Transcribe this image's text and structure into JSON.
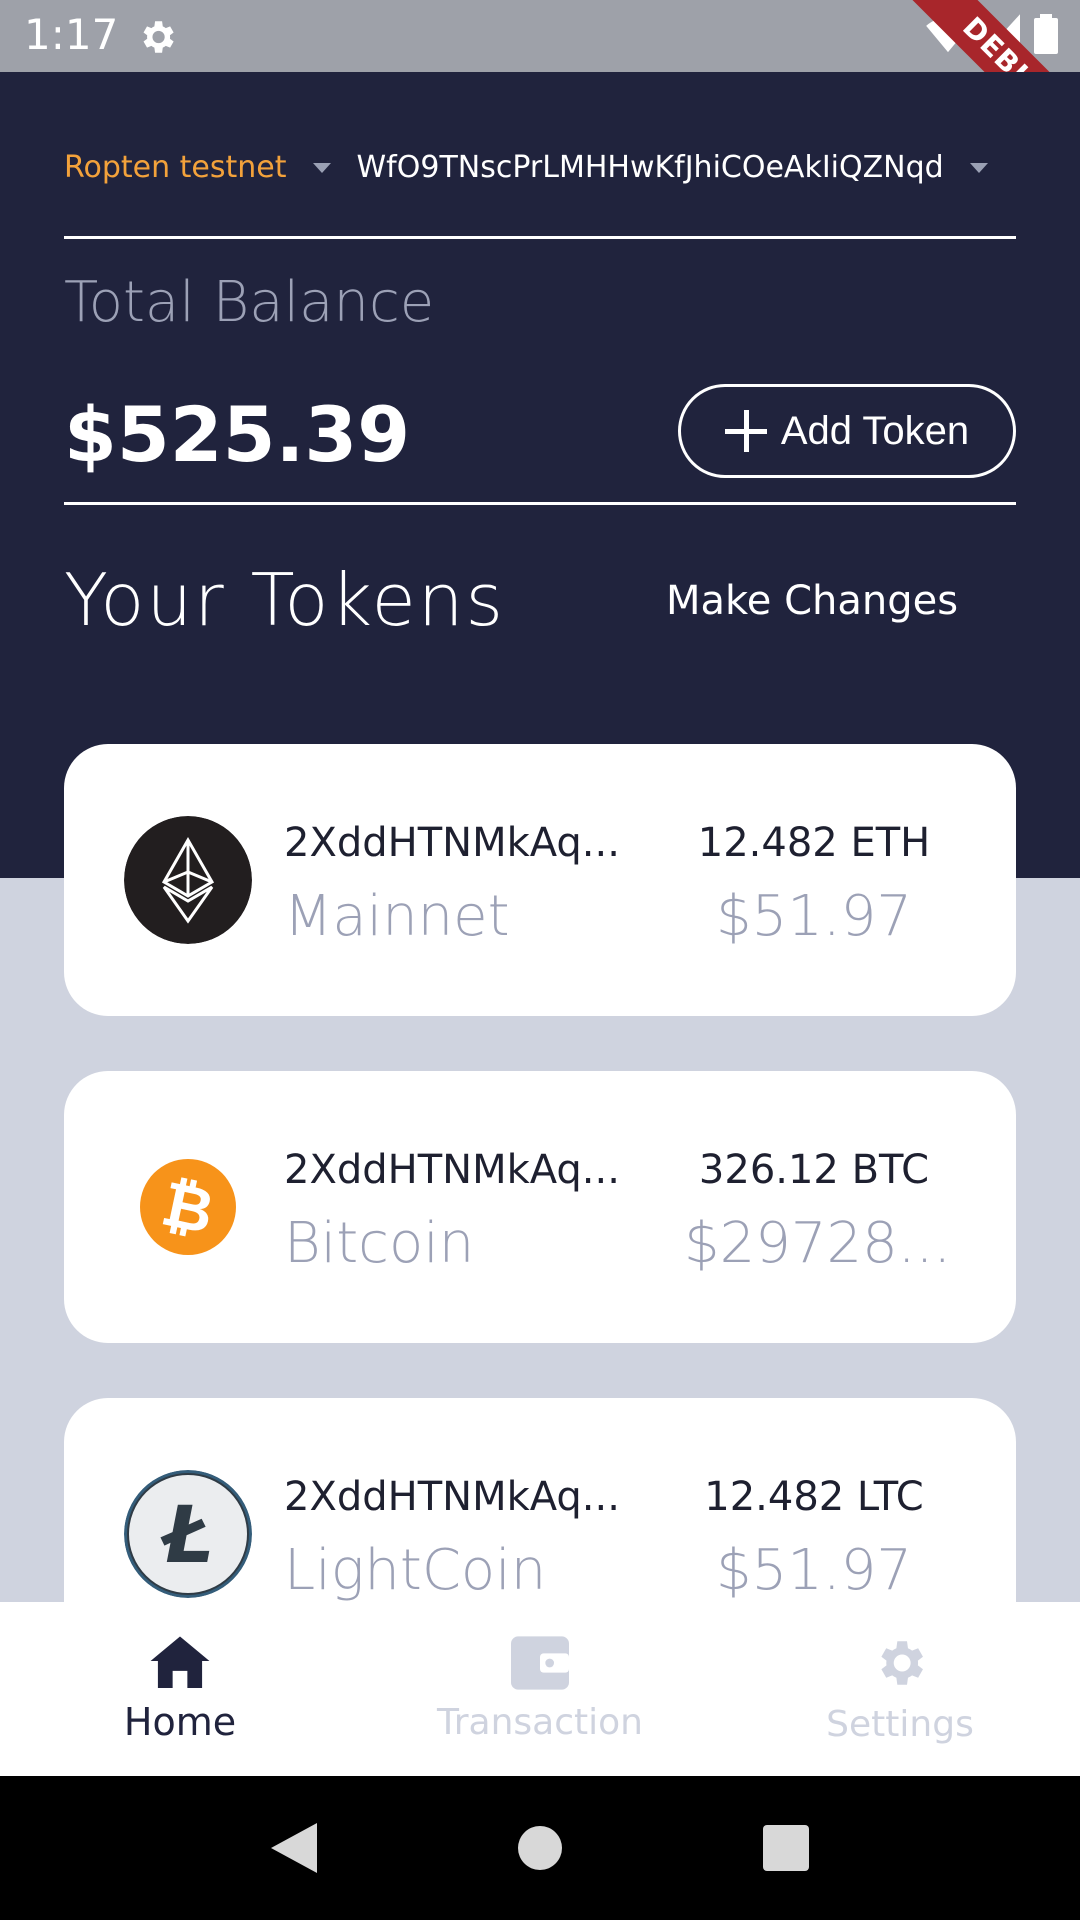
{
  "status_bar": {
    "time": "1:17",
    "debug_label": "DEBUG"
  },
  "header": {
    "network": "Ropten testnet",
    "account": "WfO9TNscPrLMHHwKfJhiCOeAkIiQZNqd",
    "total_label": "Total Balance",
    "balance": "$525.39",
    "add_token_label": "Add Token",
    "tokens_title": "Your Tokens",
    "make_changes_label": "Make Changes"
  },
  "tokens": [
    {
      "address": "2XddHTNMkAq...",
      "name": "Mainnet",
      "amount": "12.482 ETH",
      "usd": "$51.97",
      "icon": "ethereum-icon"
    },
    {
      "address": "2XddHTNMkAq...",
      "name": "Bitcoin",
      "amount": "326.12 BTC",
      "usd": "$29728...",
      "icon": "bitcoin-icon"
    },
    {
      "address": "2XddHTNMkAq...",
      "name": "LightCoin",
      "amount": "12.482 LTC",
      "usd": "$51.97",
      "icon": "litecoin-icon"
    }
  ],
  "bottom_nav": [
    {
      "label": "Home",
      "icon": "home-icon",
      "active": true
    },
    {
      "label": "Transaction",
      "icon": "wallet-icon",
      "active": false
    },
    {
      "label": "Settings",
      "icon": "gear-icon",
      "active": false
    }
  ],
  "colors": {
    "header_bg": "#20233d",
    "accent_orange": "#f3a23b",
    "body_bg": "#cfd3df",
    "muted_text": "#9ca1b6"
  }
}
